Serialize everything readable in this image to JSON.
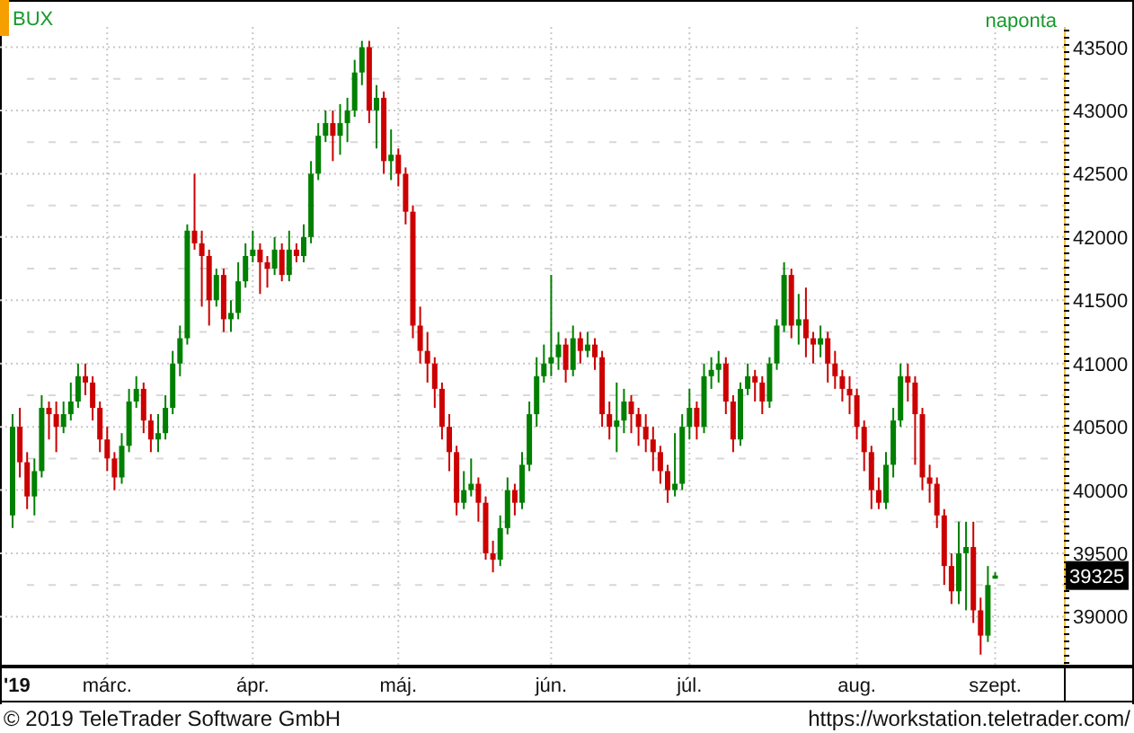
{
  "chart": {
    "instrument": "BUX",
    "interval": "naponta",
    "current_price": "39325",
    "year_label": "'19",
    "chart_data": {
      "type": "candlestick",
      "grid": true,
      "ylim": [
        38620,
        43660
      ],
      "yticks": [
        39000,
        39500,
        40000,
        40500,
        41000,
        41500,
        42000,
        42500,
        43000,
        43500
      ],
      "categories": [
        null,
        null,
        null,
        null,
        null,
        null,
        null,
        null,
        null,
        null,
        null,
        null,
        null,
        "márc.",
        null,
        null,
        null,
        null,
        null,
        null,
        null,
        null,
        null,
        null,
        null,
        null,
        null,
        null,
        null,
        null,
        null,
        null,
        null,
        "ápr.",
        null,
        null,
        null,
        null,
        null,
        null,
        null,
        null,
        null,
        null,
        null,
        null,
        null,
        null,
        null,
        null,
        null,
        null,
        null,
        "máj.",
        null,
        null,
        null,
        null,
        null,
        null,
        null,
        null,
        null,
        null,
        null,
        null,
        null,
        null,
        null,
        null,
        null,
        null,
        null,
        null,
        "jún.",
        null,
        null,
        null,
        null,
        null,
        null,
        null,
        null,
        null,
        null,
        null,
        null,
        null,
        null,
        null,
        null,
        null,
        null,
        "júl.",
        null,
        null,
        null,
        null,
        null,
        null,
        null,
        null,
        null,
        null,
        null,
        null,
        null,
        null,
        null,
        null,
        null,
        null,
        null,
        null,
        null,
        null,
        "aug.",
        null,
        null,
        null,
        null,
        null,
        null,
        null,
        null,
        null,
        null,
        null,
        null,
        null,
        null,
        null,
        null,
        null,
        null,
        "szept."
      ],
      "ohlc": [
        [
          39800,
          40600,
          39700,
          40500
        ],
        [
          40500,
          40650,
          40100,
          40220
        ],
        [
          40220,
          40300,
          39850,
          39950
        ],
        [
          39950,
          40250,
          39800,
          40150
        ],
        [
          40150,
          40750,
          40100,
          40650
        ],
        [
          40650,
          40700,
          40400,
          40600
        ],
        [
          40600,
          40700,
          40300,
          40500
        ],
        [
          40500,
          40700,
          40450,
          40600
        ],
        [
          40600,
          40850,
          40550,
          40700
        ],
        [
          40700,
          41000,
          40650,
          40900
        ],
        [
          40900,
          41000,
          40750,
          40850
        ],
        [
          40850,
          40900,
          40550,
          40650
        ],
        [
          40650,
          40700,
          40300,
          40400
        ],
        [
          40400,
          40500,
          40150,
          40250
        ],
        [
          40250,
          40300,
          40000,
          40100
        ],
        [
          40100,
          40450,
          40050,
          40350
        ],
        [
          40350,
          40800,
          40300,
          40700
        ],
        [
          40700,
          40900,
          40650,
          40800
        ],
        [
          40800,
          40850,
          40450,
          40550
        ],
        [
          40550,
          40600,
          40300,
          40400
        ],
        [
          40400,
          40600,
          40300,
          40450
        ],
        [
          40450,
          40750,
          40400,
          40650
        ],
        [
          40650,
          41100,
          40600,
          41000
        ],
        [
          41000,
          41300,
          40900,
          41200
        ],
        [
          41200,
          42100,
          41150,
          42050
        ],
        [
          42050,
          42500,
          41900,
          41950
        ],
        [
          41950,
          42050,
          41450,
          41850
        ],
        [
          41850,
          41900,
          41300,
          41500
        ],
        [
          41500,
          41750,
          41450,
          41700
        ],
        [
          41700,
          41750,
          41250,
          41350
        ],
        [
          41350,
          41500,
          41250,
          41400
        ],
        [
          41400,
          41800,
          41350,
          41650
        ],
        [
          41650,
          41950,
          41600,
          41850
        ],
        [
          41850,
          42050,
          41800,
          41900
        ],
        [
          41900,
          41950,
          41550,
          41800
        ],
        [
          41800,
          41850,
          41600,
          41750
        ],
        [
          41750,
          42000,
          41700,
          41900
        ],
        [
          41900,
          41950,
          41650,
          41700
        ],
        [
          41700,
          42050,
          41650,
          41900
        ],
        [
          41900,
          41950,
          41800,
          41850
        ],
        [
          41850,
          42100,
          41800,
          42000
        ],
        [
          42000,
          42600,
          41950,
          42500
        ],
        [
          42500,
          42900,
          42450,
          42800
        ],
        [
          42800,
          43000,
          42750,
          42900
        ],
        [
          42900,
          43000,
          42600,
          42800
        ],
        [
          42800,
          43050,
          42650,
          42900
        ],
        [
          42900,
          43100,
          42750,
          43000
        ],
        [
          43000,
          43400,
          42950,
          43300
        ],
        [
          43300,
          43550,
          43200,
          43500
        ],
        [
          43500,
          43550,
          42900,
          43000
        ],
        [
          43000,
          43200,
          42700,
          43100
        ],
        [
          43100,
          43150,
          42500,
          42600
        ],
        [
          42600,
          42850,
          42450,
          42650
        ],
        [
          42650,
          42700,
          42400,
          42500
        ],
        [
          42500,
          42550,
          42100,
          42200
        ],
        [
          42200,
          42250,
          41200,
          41300
        ],
        [
          41300,
          41450,
          41000,
          41100
        ],
        [
          41100,
          41250,
          40850,
          41000
        ],
        [
          41000,
          41050,
          40650,
          40800
        ],
        [
          40800,
          40850,
          40400,
          40500
        ],
        [
          40500,
          40600,
          40150,
          40300
        ],
        [
          40300,
          40350,
          39800,
          39900
        ],
        [
          39900,
          40150,
          39850,
          40000
        ],
        [
          40000,
          40250,
          39950,
          40050
        ],
        [
          40050,
          40100,
          39750,
          39900
        ],
        [
          39900,
          39950,
          39450,
          39500
        ],
        [
          39500,
          39600,
          39350,
          39450
        ],
        [
          39450,
          39800,
          39400,
          39700
        ],
        [
          39700,
          40100,
          39650,
          40000
        ],
        [
          40000,
          40050,
          39800,
          39900
        ],
        [
          39900,
          40300,
          39850,
          40200
        ],
        [
          40200,
          40700,
          40150,
          40600
        ],
        [
          40600,
          41050,
          40500,
          40900
        ],
        [
          40900,
          41150,
          40850,
          41000
        ],
        [
          41000,
          41700,
          40900,
          41050
        ],
        [
          41050,
          41250,
          40950,
          41150
        ],
        [
          41150,
          41200,
          40850,
          40950
        ],
        [
          40950,
          41300,
          40900,
          41200
        ],
        [
          41200,
          41250,
          41000,
          41100
        ],
        [
          41100,
          41250,
          41050,
          41150
        ],
        [
          41150,
          41200,
          40950,
          41050
        ],
        [
          41050,
          41100,
          40500,
          40600
        ],
        [
          40600,
          40700,
          40400,
          40500
        ],
        [
          40500,
          40850,
          40300,
          40550
        ],
        [
          40550,
          40800,
          40450,
          40700
        ],
        [
          40700,
          40750,
          40450,
          40600
        ],
        [
          40600,
          40650,
          40350,
          40500
        ],
        [
          40500,
          40600,
          40300,
          40400
        ],
        [
          40400,
          40500,
          40150,
          40300
        ],
        [
          40300,
          40350,
          40050,
          40150
        ],
        [
          40150,
          40200,
          39900,
          40000
        ],
        [
          40000,
          40450,
          39950,
          40050
        ],
        [
          40050,
          40600,
          40000,
          40500
        ],
        [
          40500,
          40800,
          40400,
          40650
        ],
        [
          40650,
          40700,
          40400,
          40500
        ],
        [
          40500,
          41000,
          40450,
          40900
        ],
        [
          40900,
          41050,
          40800,
          40950
        ],
        [
          40950,
          41100,
          40850,
          41000
        ],
        [
          41000,
          41050,
          40600,
          40700
        ],
        [
          40700,
          40750,
          40300,
          40400
        ],
        [
          40400,
          40850,
          40350,
          40800
        ],
        [
          40800,
          41000,
          40750,
          40900
        ],
        [
          40900,
          40950,
          40700,
          40850
        ],
        [
          40850,
          40900,
          40600,
          40700
        ],
        [
          40700,
          41050,
          40650,
          41000
        ],
        [
          41000,
          41350,
          40950,
          41300
        ],
        [
          41300,
          41800,
          41250,
          41700
        ],
        [
          41700,
          41750,
          41200,
          41300
        ],
        [
          41300,
          41550,
          41150,
          41350
        ],
        [
          41350,
          41600,
          41050,
          41200
        ],
        [
          41200,
          41250,
          41000,
          41150
        ],
        [
          41150,
          41300,
          41050,
          41200
        ],
        [
          41200,
          41250,
          40850,
          41000
        ],
        [
          41000,
          41100,
          40800,
          40900
        ],
        [
          40900,
          40950,
          40700,
          40800
        ],
        [
          40800,
          40900,
          40600,
          40750
        ],
        [
          40750,
          40800,
          40400,
          40500
        ],
        [
          40500,
          40550,
          40150,
          40300
        ],
        [
          40300,
          40350,
          39850,
          40000
        ],
        [
          40000,
          40100,
          39850,
          39900
        ],
        [
          39900,
          40300,
          39850,
          40200
        ],
        [
          40200,
          40650,
          40100,
          40550
        ],
        [
          40550,
          41000,
          40500,
          40900
        ],
        [
          40900,
          41000,
          40700,
          40850
        ],
        [
          40850,
          40900,
          40200,
          40600
        ],
        [
          40600,
          40650,
          40000,
          40100
        ],
        [
          40100,
          40200,
          39900,
          40050
        ],
        [
          40050,
          40100,
          39700,
          39800
        ],
        [
          39800,
          39850,
          39250,
          39400
        ],
        [
          39400,
          39500,
          39100,
          39200
        ],
        [
          39200,
          39750,
          39100,
          39500
        ],
        [
          39500,
          39750,
          39050,
          39550
        ],
        [
          39550,
          39750,
          38950,
          39050
        ],
        [
          39050,
          39150,
          38700,
          38850
        ],
        [
          38850,
          39400,
          38800,
          39250
        ],
        [
          39300,
          39350,
          39300,
          39325
        ]
      ]
    }
  },
  "footer": {
    "copyright": "© 2019 TeleTrader Software GmbH",
    "url": "https://workstation.teletrader.com/"
  }
}
